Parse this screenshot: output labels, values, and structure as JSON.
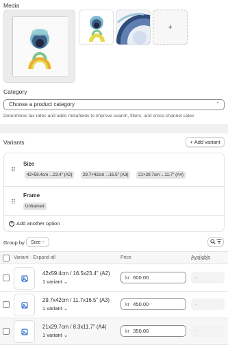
{
  "media": {
    "title": "Media",
    "add_label": "+"
  },
  "category": {
    "title": "Category",
    "placeholder": "Choose a product category",
    "help": "Determines tax rates and adds metafields to improve search, filters, and cross-channel sales"
  },
  "variants": {
    "title": "Variants",
    "add_button": "Add variant",
    "options": [
      {
        "name": "Size",
        "values": [
          "42×59.4cm ...23.4\" (A2)",
          "29.7×42cm ...16.5\" (A3)",
          "21×29.7cm ...11.7\" (A4)"
        ]
      },
      {
        "name": "Frame",
        "values": [
          "Unframed"
        ]
      }
    ],
    "add_option": "Add another option",
    "group_by_label": "Group by",
    "group_by_value": "Size",
    "table": {
      "col_variant": "Variant",
      "col_expand": "· Expand all",
      "col_price": "Price",
      "col_available": "Available",
      "currency": "kr",
      "rows": [
        {
          "name": "42x59.4cm / 16.5x23.4\" (A2)",
          "count": "1 variant",
          "price": "600.00",
          "available": "-"
        },
        {
          "name": "29.7x42cm / 11.7x16.5\" (A3)",
          "count": "1 variant",
          "price": "450.00",
          "available": "-"
        },
        {
          "name": "21x29.7cm / 8.3x11.7\" (A4)",
          "count": "1 variant",
          "price": "350.00",
          "available": "-"
        }
      ]
    }
  },
  "colors": {
    "background": "#f1f1f1",
    "card": "#ffffff",
    "border": "#e3e3e3",
    "image_icon": "#2c6ecb"
  }
}
